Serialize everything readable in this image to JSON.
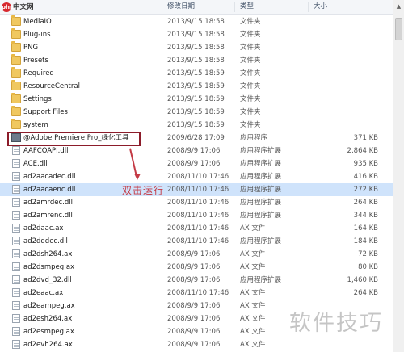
{
  "site_logo": {
    "mark": "php",
    "text": "中文网"
  },
  "columns": {
    "date": "修改日期",
    "type": "类型",
    "size": "大小"
  },
  "rows": [
    {
      "name": "MediaIO",
      "date": "2013/9/15 18:58",
      "type": "文件夹",
      "size": "",
      "icon": "folder"
    },
    {
      "name": "Plug-ins",
      "date": "2013/9/15 18:58",
      "type": "文件夹",
      "size": "",
      "icon": "folder"
    },
    {
      "name": "PNG",
      "date": "2013/9/15 18:58",
      "type": "文件夹",
      "size": "",
      "icon": "folder"
    },
    {
      "name": "Presets",
      "date": "2013/9/15 18:58",
      "type": "文件夹",
      "size": "",
      "icon": "folder"
    },
    {
      "name": "Required",
      "date": "2013/9/15 18:59",
      "type": "文件夹",
      "size": "",
      "icon": "folder"
    },
    {
      "name": "ResourceCentral",
      "date": "2013/9/15 18:59",
      "type": "文件夹",
      "size": "",
      "icon": "folder"
    },
    {
      "name": "Settings",
      "date": "2013/9/15 18:59",
      "type": "文件夹",
      "size": "",
      "icon": "folder"
    },
    {
      "name": "Support Files",
      "date": "2013/9/15 18:59",
      "type": "文件夹",
      "size": "",
      "icon": "folder"
    },
    {
      "name": "system",
      "date": "2013/9/15 18:59",
      "type": "文件夹",
      "size": "",
      "icon": "folder"
    },
    {
      "name": "@Adobe Premiere Pro_绿化工具",
      "date": "2009/6/28 17:09",
      "type": "应用程序",
      "size": "371 KB",
      "icon": "exe"
    },
    {
      "name": "AAFCOAPI.dll",
      "date": "2008/9/9 17:06",
      "type": "应用程序扩展",
      "size": "2,864 KB",
      "icon": "file"
    },
    {
      "name": "ACE.dll",
      "date": "2008/9/9 17:06",
      "type": "应用程序扩展",
      "size": "935 KB",
      "icon": "file"
    },
    {
      "name": "ad2aacadec.dll",
      "date": "2008/11/10 17:46",
      "type": "应用程序扩展",
      "size": "416 KB",
      "icon": "file"
    },
    {
      "name": "ad2aacaenc.dll",
      "date": "2008/11/10 17:46",
      "type": "应用程序扩展",
      "size": "272 KB",
      "icon": "file",
      "highlight": true
    },
    {
      "name": "ad2amrdec.dll",
      "date": "2008/11/10 17:46",
      "type": "应用程序扩展",
      "size": "264 KB",
      "icon": "file"
    },
    {
      "name": "ad2amrenc.dll",
      "date": "2008/11/10 17:46",
      "type": "应用程序扩展",
      "size": "344 KB",
      "icon": "file"
    },
    {
      "name": "ad2daac.ax",
      "date": "2008/11/10 17:46",
      "type": "AX 文件",
      "size": "164 KB",
      "icon": "file"
    },
    {
      "name": "ad2dddec.dll",
      "date": "2008/11/10 17:46",
      "type": "应用程序扩展",
      "size": "184 KB",
      "icon": "file"
    },
    {
      "name": "ad2dsh264.ax",
      "date": "2008/9/9 17:06",
      "type": "AX 文件",
      "size": "72 KB",
      "icon": "file"
    },
    {
      "name": "ad2dsmpeg.ax",
      "date": "2008/9/9 17:06",
      "type": "AX 文件",
      "size": "80 KB",
      "icon": "file"
    },
    {
      "name": "ad2dvd_32.dll",
      "date": "2008/9/9 17:06",
      "type": "应用程序扩展",
      "size": "1,460 KB",
      "icon": "file"
    },
    {
      "name": "ad2eaac.ax",
      "date": "2008/11/10 17:46",
      "type": "AX 文件",
      "size": "264 KB",
      "icon": "file"
    },
    {
      "name": "ad2eampeg.ax",
      "date": "2008/9/9 17:06",
      "type": "AX 文件",
      "size": "",
      "icon": "file"
    },
    {
      "name": "ad2esh264.ax",
      "date": "2008/9/9 17:06",
      "type": "AX 文件",
      "size": "",
      "icon": "file"
    },
    {
      "name": "ad2esmpeg.ax",
      "date": "2008/9/9 17:06",
      "type": "AX 文件",
      "size": "",
      "icon": "file"
    },
    {
      "name": "ad2evh264.ax",
      "date": "2008/9/9 17:06",
      "type": "AX 文件",
      "size": "",
      "icon": "file"
    }
  ],
  "annotation": "双击运行",
  "watermark": "软件技巧",
  "colors": {
    "annotation": "#c43a45",
    "box": "#8c1c2a",
    "selected_row": "#cfe3fb"
  }
}
